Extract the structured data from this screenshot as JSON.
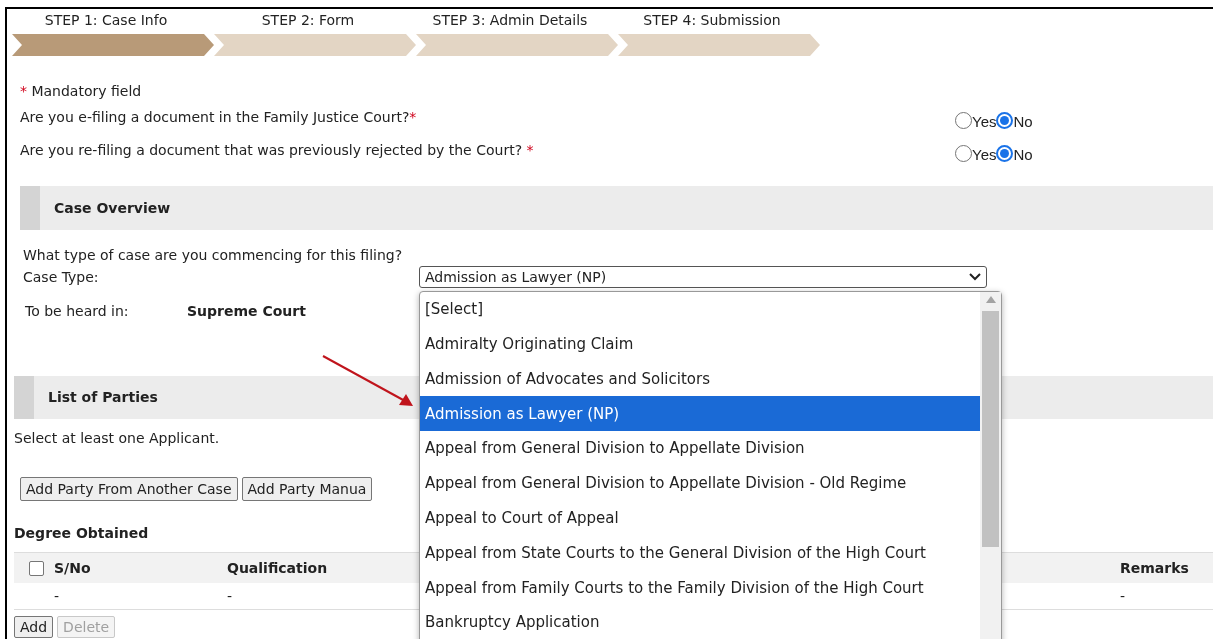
{
  "steps": [
    {
      "label": "STEP 1: Case Info",
      "selected": true
    },
    {
      "label": "STEP 2: Form",
      "selected": false
    },
    {
      "label": "STEP 3: Admin Details",
      "selected": false
    },
    {
      "label": "STEP 4: Submission",
      "selected": false
    }
  ],
  "mandatory_note": {
    "marker": "*",
    "text": "Mandatory field"
  },
  "questions": [
    {
      "text": "Are you e-filing a document in the Family Justice Court?",
      "marker": "*",
      "options": [
        {
          "label": "Yes",
          "selected": false
        },
        {
          "label": "No",
          "selected": true
        }
      ]
    },
    {
      "text": "Are you re-filing a document that was previously rejected by the Court?",
      "marker": "*",
      "options": [
        {
          "label": "Yes",
          "selected": false
        },
        {
          "label": "No",
          "selected": true
        }
      ]
    }
  ],
  "case_overview": {
    "title": "Case Overview",
    "question": "What type of case are you commencing for this filing?",
    "case_type_label": "Case Type:",
    "case_type_value": "Admission as Lawyer (NP)",
    "heard_in_label": "To be heard in:",
    "heard_in_value": "Supreme Court"
  },
  "dropdown": {
    "items": [
      {
        "label": "[Select]",
        "selected": false
      },
      {
        "label": "Admiralty Originating Claim",
        "selected": false
      },
      {
        "label": "Admission of Advocates and Solicitors",
        "selected": false
      },
      {
        "label": "Admission as Lawyer (NP)",
        "selected": true
      },
      {
        "label": "Appeal from General Division to Appellate Division",
        "selected": false
      },
      {
        "label": "Appeal from General Division to Appellate Division - Old Regime",
        "selected": false
      },
      {
        "label": "Appeal to Court of Appeal",
        "selected": false
      },
      {
        "label": "Appeal from State Courts to the General Division of the High Court",
        "selected": false
      },
      {
        "label": "Appeal from Family Courts to the Family Division of the High Court",
        "selected": false
      },
      {
        "label": "Bankruptcy Application",
        "selected": false
      }
    ]
  },
  "list_of_parties": {
    "title": "List of Parties",
    "note": "Select at least one Applicant.",
    "buttons": [
      "Add Party From Another Case",
      "Add Party Manua"
    ]
  },
  "degree": {
    "title": "Degree Obtained",
    "select_all_checked": false,
    "columns": [
      "S/No",
      "Qualification",
      "Remarks"
    ],
    "rows": [
      {
        "cells": [
          "-",
          "-",
          "-"
        ]
      }
    ],
    "buttons": [
      {
        "label": "Add",
        "disabled": false
      },
      {
        "label": "Delete",
        "disabled": true
      }
    ]
  }
}
